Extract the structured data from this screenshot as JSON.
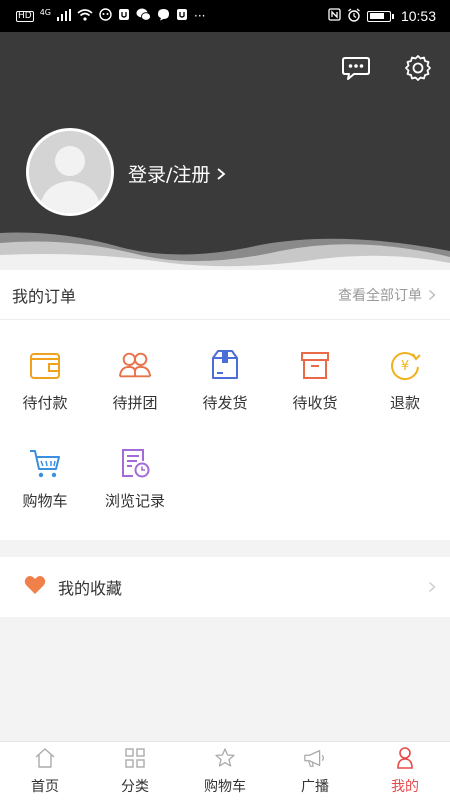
{
  "status_bar": {
    "left_icons": [
      "HD",
      "4G",
      "signal-icon",
      "wifi-icon",
      "app-icon",
      "app-icon",
      "wechat-icon",
      "chat-icon",
      "app-icon",
      "more-icon"
    ],
    "time": "10:53"
  },
  "header": {
    "login_text": "登录/注册",
    "bg_color": "#3a3a3a"
  },
  "orders": {
    "title": "我的订单",
    "view_all": "查看全部订单",
    "items": [
      {
        "label": "待付款",
        "icon": "wallet-icon",
        "color": "#f0a21c"
      },
      {
        "label": "待拼团",
        "icon": "group-icon",
        "color": "#e8734a"
      },
      {
        "label": "待发货",
        "icon": "package-icon",
        "color": "#4b6fd6"
      },
      {
        "label": "待收货",
        "icon": "box-icon",
        "color": "#e86a48"
      },
      {
        "label": "退款",
        "icon": "refund-icon",
        "color": "#f0b21c"
      },
      {
        "label": "购物车",
        "icon": "cart-icon",
        "color": "#3b8fe0"
      },
      {
        "label": "浏览记录",
        "icon": "history-icon",
        "color": "#a36ad8"
      }
    ]
  },
  "favorites": {
    "label": "我的收藏",
    "icon_color": "#f07f4a"
  },
  "tabbar": {
    "items": [
      {
        "label": "首页",
        "icon": "home-icon"
      },
      {
        "label": "分类",
        "icon": "category-icon"
      },
      {
        "label": "购物车",
        "icon": "cart-tab-icon"
      },
      {
        "label": "广播",
        "icon": "broadcast-icon"
      },
      {
        "label": "我的",
        "icon": "user-icon",
        "active": true
      }
    ],
    "active_color": "#e84a4a"
  }
}
